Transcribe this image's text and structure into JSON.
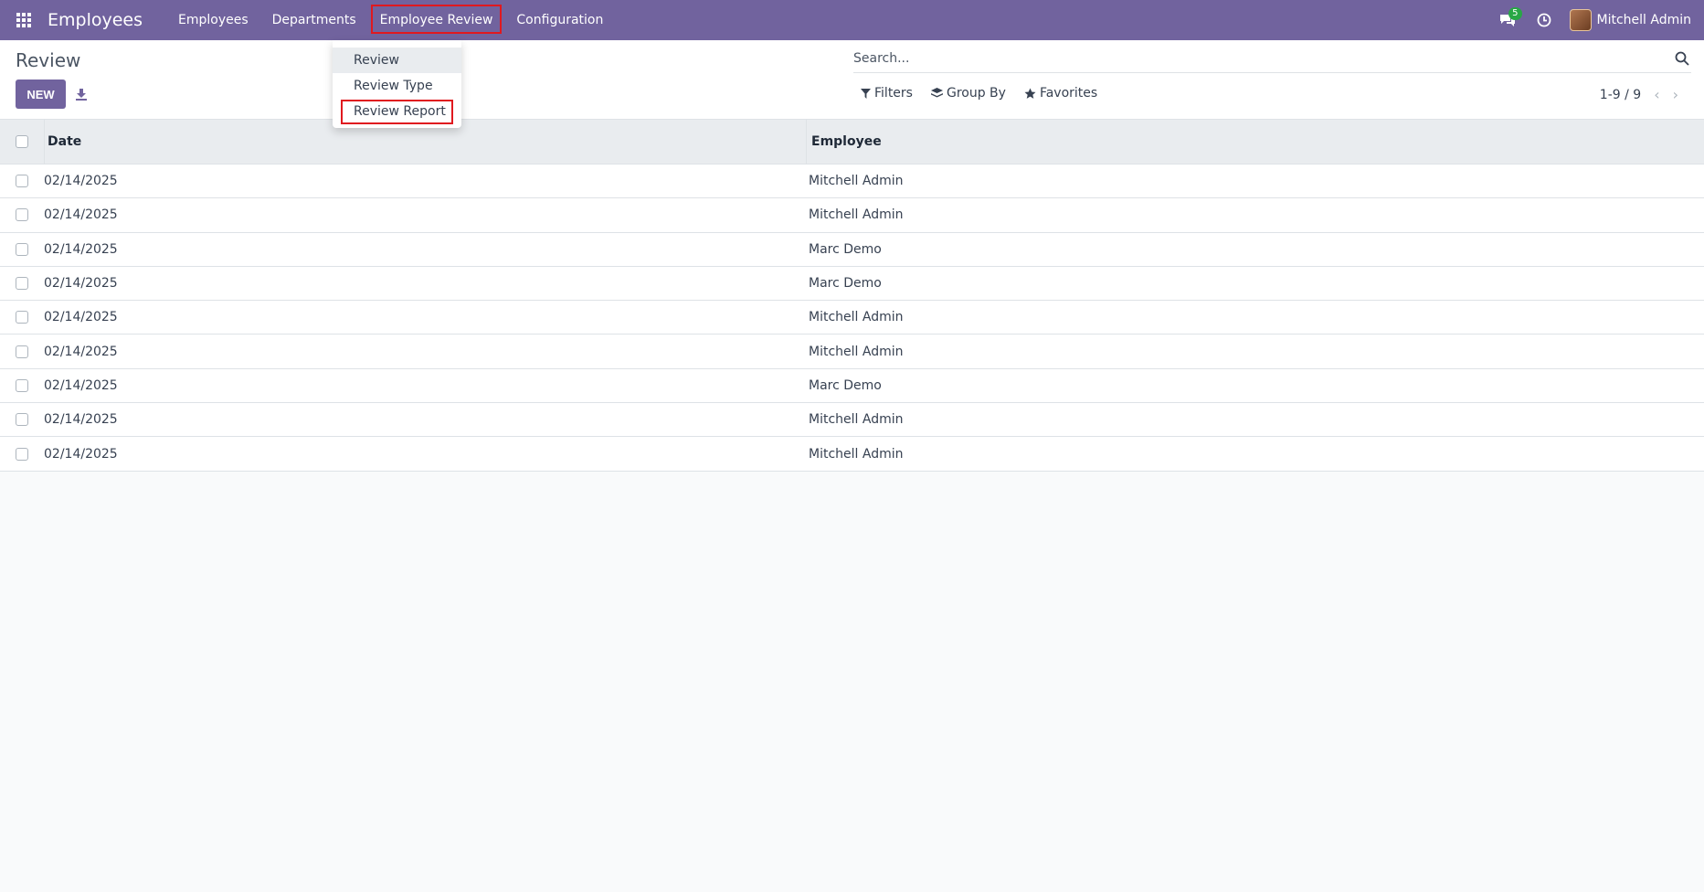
{
  "navbar": {
    "brand": "Employees",
    "menu": [
      "Employees",
      "Departments",
      "Employee Review",
      "Configuration"
    ],
    "chat_badge": "5",
    "user_name": "Mitchell Admin",
    "color": "#71639e"
  },
  "dropdown": {
    "items": [
      "Review",
      "Review Type",
      "Review Report"
    ]
  },
  "control": {
    "title": "Review",
    "new_label": "NEW",
    "search_placeholder": "Search...",
    "filters_label": "Filters",
    "groupby_label": "Group By",
    "favorites_label": "Favorites",
    "pager": "1-9 / 9"
  },
  "table": {
    "headers": [
      "Date",
      "Employee"
    ],
    "rows": [
      {
        "date": "02/14/2025",
        "employee": "Mitchell Admin"
      },
      {
        "date": "02/14/2025",
        "employee": "Mitchell Admin"
      },
      {
        "date": "02/14/2025",
        "employee": "Marc Demo"
      },
      {
        "date": "02/14/2025",
        "employee": "Marc Demo"
      },
      {
        "date": "02/14/2025",
        "employee": "Mitchell Admin"
      },
      {
        "date": "02/14/2025",
        "employee": "Mitchell Admin"
      },
      {
        "date": "02/14/2025",
        "employee": "Marc Demo"
      },
      {
        "date": "02/14/2025",
        "employee": "Mitchell Admin"
      },
      {
        "date": "02/14/2025",
        "employee": "Mitchell Admin"
      }
    ]
  }
}
